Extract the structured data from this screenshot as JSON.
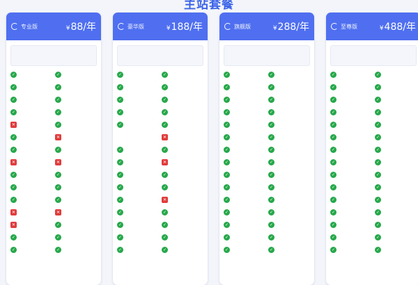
{
  "page_title": "主站套餐",
  "colors": {
    "header_bg": "#4f6ff0",
    "check": "#26a84a",
    "cross": "#e03c3c",
    "title": "#3c64e8"
  },
  "plans": [
    {
      "name": "专业版",
      "currency": "¥",
      "price": "88/年",
      "summary": [
        "",
        "",
        ""
      ],
      "features": [
        {
          "label": "",
          "status": "yes"
        },
        {
          "label": "",
          "status": "yes"
        },
        {
          "label": "",
          "status": "yes"
        },
        {
          "label": "",
          "status": "yes"
        },
        {
          "label": "",
          "status": "yes"
        },
        {
          "label": "",
          "status": "yes"
        },
        {
          "label": "",
          "status": "yes"
        },
        {
          "label": "",
          "status": "yes"
        },
        {
          "label": "",
          "status": "no"
        },
        {
          "label": "",
          "status": "yes"
        },
        {
          "label": "",
          "status": "yes"
        },
        {
          "label": "",
          "status": "no"
        },
        {
          "label": "",
          "status": "yes"
        },
        {
          "label": "",
          "status": "yes"
        },
        {
          "label": "",
          "status": "no"
        },
        {
          "label": "",
          "status": "no"
        },
        {
          "label": "",
          "status": "yes"
        },
        {
          "label": "",
          "status": "yes"
        },
        {
          "label": "",
          "status": "yes"
        },
        {
          "label": "",
          "status": "yes"
        },
        {
          "label": "",
          "status": "yes"
        },
        {
          "label": "",
          "status": "yes"
        },
        {
          "label": "",
          "status": "no"
        },
        {
          "label": "",
          "status": "no"
        },
        {
          "label": "",
          "status": "no"
        },
        {
          "label": "",
          "status": "yes"
        },
        {
          "label": "",
          "status": "yes"
        },
        {
          "label": "",
          "status": "yes"
        },
        {
          "label": "",
          "status": "yes"
        },
        {
          "label": "",
          "status": "yes"
        }
      ]
    },
    {
      "name": "豪华版",
      "currency": "¥",
      "price": "188/年",
      "summary": [
        "",
        "",
        ""
      ],
      "features": [
        {
          "label": "",
          "status": "yes"
        },
        {
          "label": "",
          "status": "yes"
        },
        {
          "label": "",
          "status": "yes"
        },
        {
          "label": "",
          "status": "yes"
        },
        {
          "label": "",
          "status": "yes"
        },
        {
          "label": "",
          "status": "yes"
        },
        {
          "label": "",
          "status": "yes"
        },
        {
          "label": "",
          "status": "yes"
        },
        {
          "label": "",
          "status": "yes"
        },
        {
          "label": "",
          "status": "yes"
        },
        {
          "label": "",
          "status": "none"
        },
        {
          "label": "",
          "status": "no"
        },
        {
          "label": "",
          "status": "yes"
        },
        {
          "label": "",
          "status": "yes"
        },
        {
          "label": "",
          "status": "yes"
        },
        {
          "label": "",
          "status": "no"
        },
        {
          "label": "",
          "status": "yes"
        },
        {
          "label": "",
          "status": "yes"
        },
        {
          "label": "",
          "status": "yes"
        },
        {
          "label": "",
          "status": "yes"
        },
        {
          "label": "",
          "status": "yes"
        },
        {
          "label": "",
          "status": "no"
        },
        {
          "label": "",
          "status": "yes"
        },
        {
          "label": "",
          "status": "yes"
        },
        {
          "label": "",
          "status": "yes"
        },
        {
          "label": "",
          "status": "yes"
        },
        {
          "label": "",
          "status": "yes"
        },
        {
          "label": "",
          "status": "yes"
        },
        {
          "label": "",
          "status": "yes"
        },
        {
          "label": "",
          "status": "yes"
        }
      ]
    },
    {
      "name": "旗舰版",
      "currency": "¥",
      "price": "288/年",
      "summary": [
        "",
        "",
        ""
      ],
      "features": [
        {
          "label": "",
          "status": "yes"
        },
        {
          "label": "",
          "status": "yes"
        },
        {
          "label": "",
          "status": "yes"
        },
        {
          "label": "",
          "status": "yes"
        },
        {
          "label": "",
          "status": "yes"
        },
        {
          "label": "",
          "status": "yes"
        },
        {
          "label": "",
          "status": "yes"
        },
        {
          "label": "",
          "status": "yes"
        },
        {
          "label": "",
          "status": "yes"
        },
        {
          "label": "",
          "status": "yes"
        },
        {
          "label": "",
          "status": "yes"
        },
        {
          "label": "",
          "status": "yes"
        },
        {
          "label": "",
          "status": "yes"
        },
        {
          "label": "",
          "status": "yes"
        },
        {
          "label": "",
          "status": "yes"
        },
        {
          "label": "",
          "status": "yes"
        },
        {
          "label": "",
          "status": "yes"
        },
        {
          "label": "",
          "status": "yes"
        },
        {
          "label": "",
          "status": "yes"
        },
        {
          "label": "",
          "status": "yes"
        },
        {
          "label": "",
          "status": "yes"
        },
        {
          "label": "",
          "status": "yes"
        },
        {
          "label": "",
          "status": "yes"
        },
        {
          "label": "",
          "status": "yes"
        },
        {
          "label": "",
          "status": "yes"
        },
        {
          "label": "",
          "status": "yes"
        },
        {
          "label": "",
          "status": "yes"
        },
        {
          "label": "",
          "status": "yes"
        },
        {
          "label": "",
          "status": "yes"
        },
        {
          "label": "",
          "status": "yes"
        }
      ]
    },
    {
      "name": "至尊版",
      "currency": "¥",
      "price": "488/年",
      "summary": [
        "",
        "",
        ""
      ],
      "features": [
        {
          "label": "",
          "status": "yes"
        },
        {
          "label": "",
          "status": "yes"
        },
        {
          "label": "",
          "status": "yes"
        },
        {
          "label": "",
          "status": "yes"
        },
        {
          "label": "",
          "status": "yes"
        },
        {
          "label": "",
          "status": "yes"
        },
        {
          "label": "",
          "status": "yes"
        },
        {
          "label": "",
          "status": "yes"
        },
        {
          "label": "",
          "status": "yes"
        },
        {
          "label": "",
          "status": "yes"
        },
        {
          "label": "",
          "status": "yes"
        },
        {
          "label": "",
          "status": "yes"
        },
        {
          "label": "",
          "status": "yes"
        },
        {
          "label": "",
          "status": "yes"
        },
        {
          "label": "",
          "status": "yes"
        },
        {
          "label": "",
          "status": "yes"
        },
        {
          "label": "",
          "status": "yes"
        },
        {
          "label": "",
          "status": "yes"
        },
        {
          "label": "",
          "status": "yes"
        },
        {
          "label": "",
          "status": "yes"
        },
        {
          "label": "",
          "status": "yes"
        },
        {
          "label": "",
          "status": "yes"
        },
        {
          "label": "",
          "status": "yes"
        },
        {
          "label": "",
          "status": "yes"
        },
        {
          "label": "",
          "status": "yes"
        },
        {
          "label": "",
          "status": "yes"
        },
        {
          "label": "",
          "status": "yes"
        },
        {
          "label": "",
          "status": "yes"
        },
        {
          "label": "",
          "status": "yes"
        },
        {
          "label": "",
          "status": "yes"
        }
      ]
    }
  ]
}
